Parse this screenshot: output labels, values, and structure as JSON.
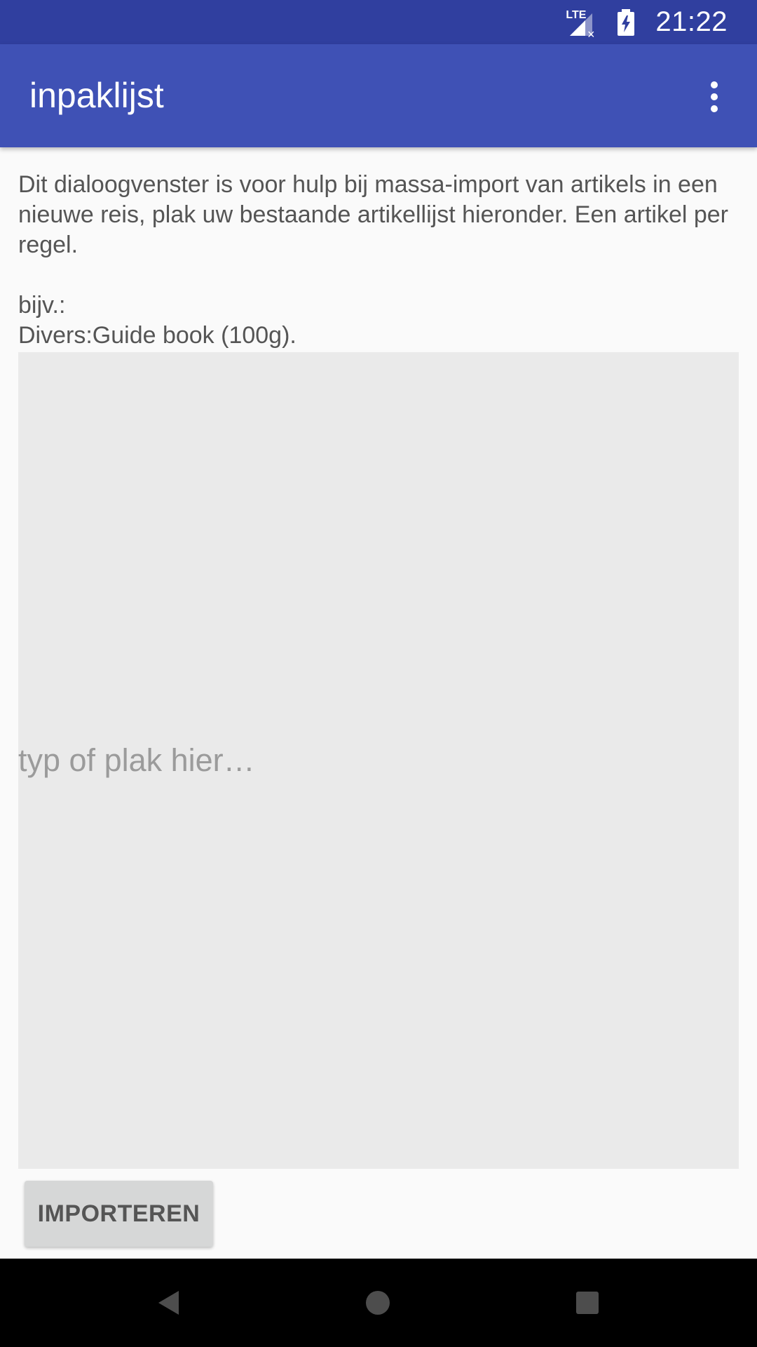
{
  "status_bar": {
    "network_type": "LTE",
    "time": "21:22"
  },
  "app_bar": {
    "title": "inpaklijst",
    "menu_icon": "overflow-menu-icon"
  },
  "instructions": {
    "line1": "Dit dialoogvenster is voor hulp bij massa-import van artikels in een nieuwe reis, plak uw bestaande artikellijst hieronder. Een artikel per regel.",
    "example_label": "bijv.:",
    "example_value": "Divers:Guide book (100g)."
  },
  "import_area": {
    "placeholder": "typ of plak hier…",
    "value": ""
  },
  "actions": {
    "import_label": "IMPORTEREN"
  },
  "nav_bar": {
    "back_icon": "back-icon",
    "home_icon": "home-icon",
    "recents_icon": "recents-icon"
  },
  "colors": {
    "status_bar": "#303f9f",
    "app_bar": "#3f51b5",
    "background": "#fafafa",
    "text_area": "#eaeaea",
    "button": "#d6d7d7"
  }
}
